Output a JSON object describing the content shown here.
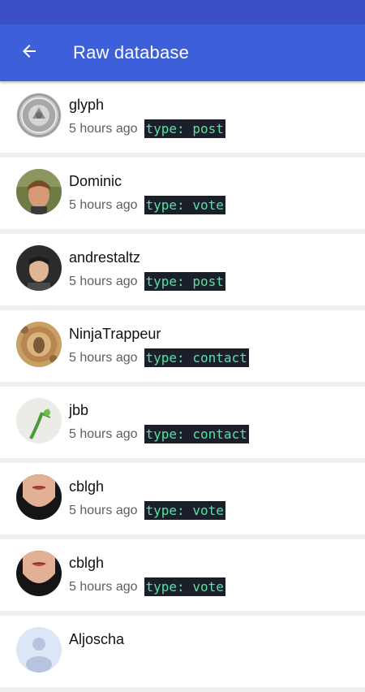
{
  "app_bar": {
    "title": "Raw database",
    "back_icon": "arrow-left-icon",
    "color": "#3d5fd9",
    "status_bar_color": "#3a4fc4"
  },
  "badge_colors": {
    "background": "#1b1f2a",
    "text": "#58e0a6"
  },
  "messages": [
    {
      "author": "glyph",
      "time": "5 hours ago",
      "type": "type: post",
      "avatar": "coin-avatar"
    },
    {
      "author": "Dominic",
      "time": "5 hours ago",
      "type": "type: vote",
      "avatar": "photo-avatar"
    },
    {
      "author": "andrestaltz",
      "time": "5 hours ago",
      "type": "type: post",
      "avatar": "photo-avatar"
    },
    {
      "author": "NinjaTrappeur",
      "time": "5 hours ago",
      "type": "type: contact",
      "avatar": "photo-avatar"
    },
    {
      "author": "jbb",
      "time": "5 hours ago",
      "type": "type: contact",
      "avatar": "plant-avatar"
    },
    {
      "author": "cblgh",
      "time": "5 hours ago",
      "type": "type: vote",
      "avatar": "photo-avatar"
    },
    {
      "author": "cblgh",
      "time": "5 hours ago",
      "type": "type: vote",
      "avatar": "photo-avatar"
    },
    {
      "author": "Aljoscha",
      "time": "",
      "type": "",
      "avatar": "default-avatar"
    }
  ]
}
